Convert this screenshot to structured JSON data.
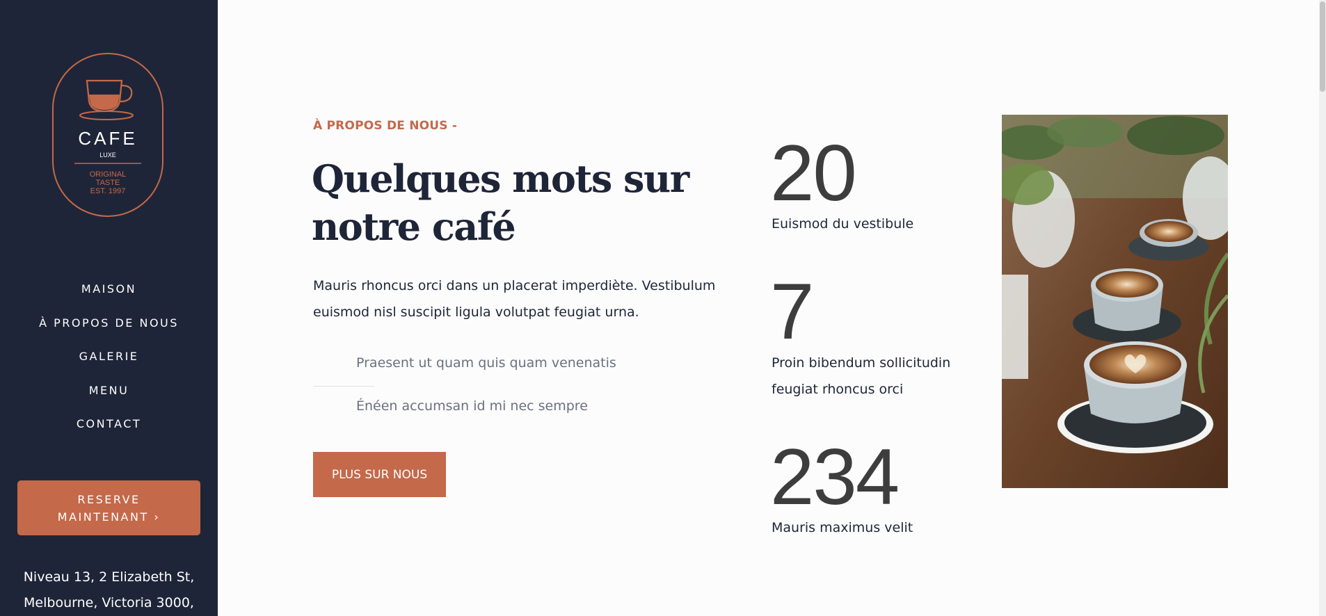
{
  "logo": {
    "brand": "CAFE",
    "sub": "LUXE",
    "tagline_1": "ORIGINAL",
    "tagline_2": "TASTE",
    "tagline_3": "EST. 1997"
  },
  "nav": {
    "items": [
      "MAISON",
      "À PROPOS DE NOUS",
      "GALERIE",
      "MENU",
      "CONTACT"
    ]
  },
  "reserve": {
    "line1": "RESERVE",
    "line2": "MAINTENANT ›"
  },
  "address": {
    "line1": "Niveau 13, 2 Elizabeth St,",
    "line2": "Melbourne, Victoria 3000,"
  },
  "about": {
    "eyebrow": "À PROPOS DE NOUS -",
    "title_line1": "Quelques mots sur",
    "title_line2": "notre café",
    "intro": "Mauris rhoncus orci dans un placerat imperdiète. Vestibulum euismod nisl suscipit ligula volutpat feugiat urna.",
    "features": [
      "Praesent ut quam quis quam venenatis",
      "Énéen accumsan id mi nec sempre"
    ],
    "cta": "PLUS SUR NOUS"
  },
  "stats": [
    {
      "number": "20",
      "label": "Euismod du vestibule"
    },
    {
      "number": "7",
      "label": "Proin bibendum sollicitudin feugiat rhoncus orci"
    },
    {
      "number": "234",
      "label": "Mauris maximus velit"
    }
  ],
  "colors": {
    "sidebar_bg": "#1f2538",
    "accent": "#c4694a",
    "page_bg": "#fcfcfc",
    "heading": "#1f2538"
  }
}
